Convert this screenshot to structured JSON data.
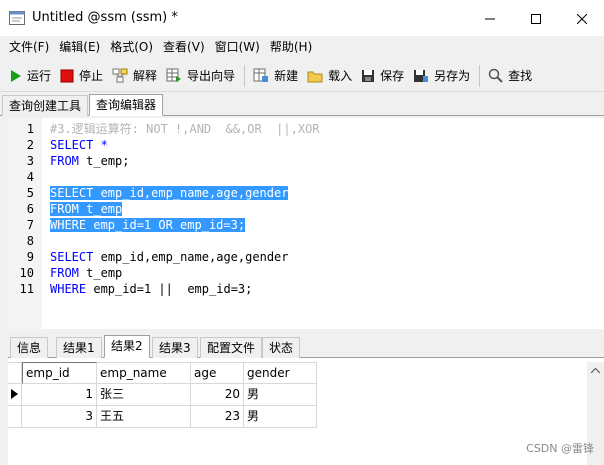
{
  "window": {
    "title": "Untitled @ssm (ssm) *"
  },
  "menu": [
    "文件(F)",
    "编辑(E)",
    "格式(O)",
    "查看(V)",
    "窗口(W)",
    "帮助(H)"
  ],
  "toolbar": {
    "run": "运行",
    "stop": "停止",
    "explain": "解释",
    "export_wizard": "导出向导",
    "new": "新建",
    "load": "载入",
    "save": "保存",
    "save_as": "另存为",
    "find": "查找"
  },
  "top_tabs": [
    "查询创建工具",
    "查询编辑器"
  ],
  "editor": {
    "line_numbers": [
      "1",
      "2",
      "3",
      "4",
      "5",
      "6",
      "7",
      "8",
      "9",
      "10",
      "11"
    ],
    "lines": [
      "#3.逻辑运算符: NOT !,AND  &&,OR  ||,XOR",
      "SELECT *",
      "FROM t_emp;",
      "",
      "SELECT emp_id,emp_name,age,gender",
      "FROM t_emp",
      "WHERE emp_id=1 OR emp_id=3;",
      "",
      "SELECT emp_id,emp_name,age,gender",
      "FROM t_emp",
      "WHERE emp_id=1 ||  emp_id=3;"
    ],
    "selected_lines": [
      5,
      6,
      7
    ]
  },
  "result_tabs": [
    "信息",
    "结果1",
    "结果2",
    "结果3",
    "配置文件",
    "状态"
  ],
  "active_result_tab": "结果2",
  "grid": {
    "columns": [
      "emp_id",
      "emp_name",
      "age",
      "gender"
    ],
    "rows": [
      [
        "1",
        "张三",
        "20",
        "男"
      ],
      [
        "3",
        "王五",
        "23",
        "男"
      ]
    ]
  },
  "watermark": "CSDN @雷锋",
  "colors": {
    "selection": "#3399ff",
    "keyword": "#0000ff",
    "comment": "#b4b4b4",
    "run_green": "#1a9e1a",
    "stop_red": "#e01010"
  }
}
